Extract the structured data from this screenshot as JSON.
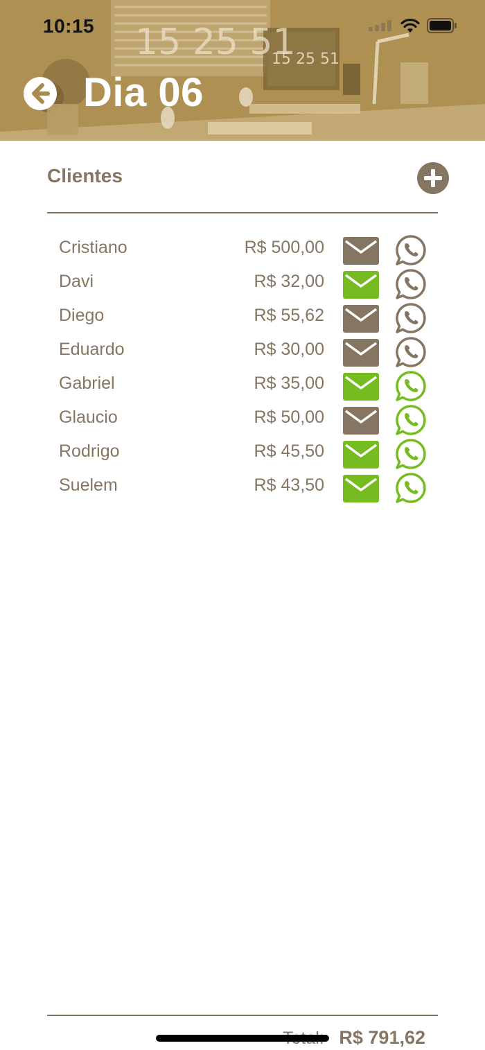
{
  "status_bar": {
    "time": "10:15"
  },
  "header": {
    "title": "Dia 06"
  },
  "section": {
    "title": "Clientes"
  },
  "clients": [
    {
      "name": "Cristiano",
      "amount": "R$ 500,00",
      "email_sent": false,
      "whatsapp_sent": false
    },
    {
      "name": "Davi",
      "amount": "R$ 32,00",
      "email_sent": true,
      "whatsapp_sent": false
    },
    {
      "name": "Diego",
      "amount": "R$ 55,62",
      "email_sent": false,
      "whatsapp_sent": false
    },
    {
      "name": "Eduardo",
      "amount": "R$ 30,00",
      "email_sent": false,
      "whatsapp_sent": false
    },
    {
      "name": "Gabriel",
      "amount": "R$ 35,00",
      "email_sent": true,
      "whatsapp_sent": true
    },
    {
      "name": "Glaucio",
      "amount": "R$ 50,00",
      "email_sent": false,
      "whatsapp_sent": true
    },
    {
      "name": "Rodrigo",
      "amount": "R$ 45,50",
      "email_sent": true,
      "whatsapp_sent": true
    },
    {
      "name": "Suelem",
      "amount": "R$ 43,50",
      "email_sent": true,
      "whatsapp_sent": true
    }
  ],
  "footer": {
    "total_label": "Total:",
    "total_value": "R$ 791,62"
  },
  "colors": {
    "accent": "#857663",
    "success": "#76bc21",
    "header_tint": "#a88b4c"
  },
  "icons": {
    "back": "arrow-left-circle-icon",
    "add": "plus-circle-icon",
    "email": "envelope-icon",
    "whatsapp": "whatsapp-icon"
  }
}
